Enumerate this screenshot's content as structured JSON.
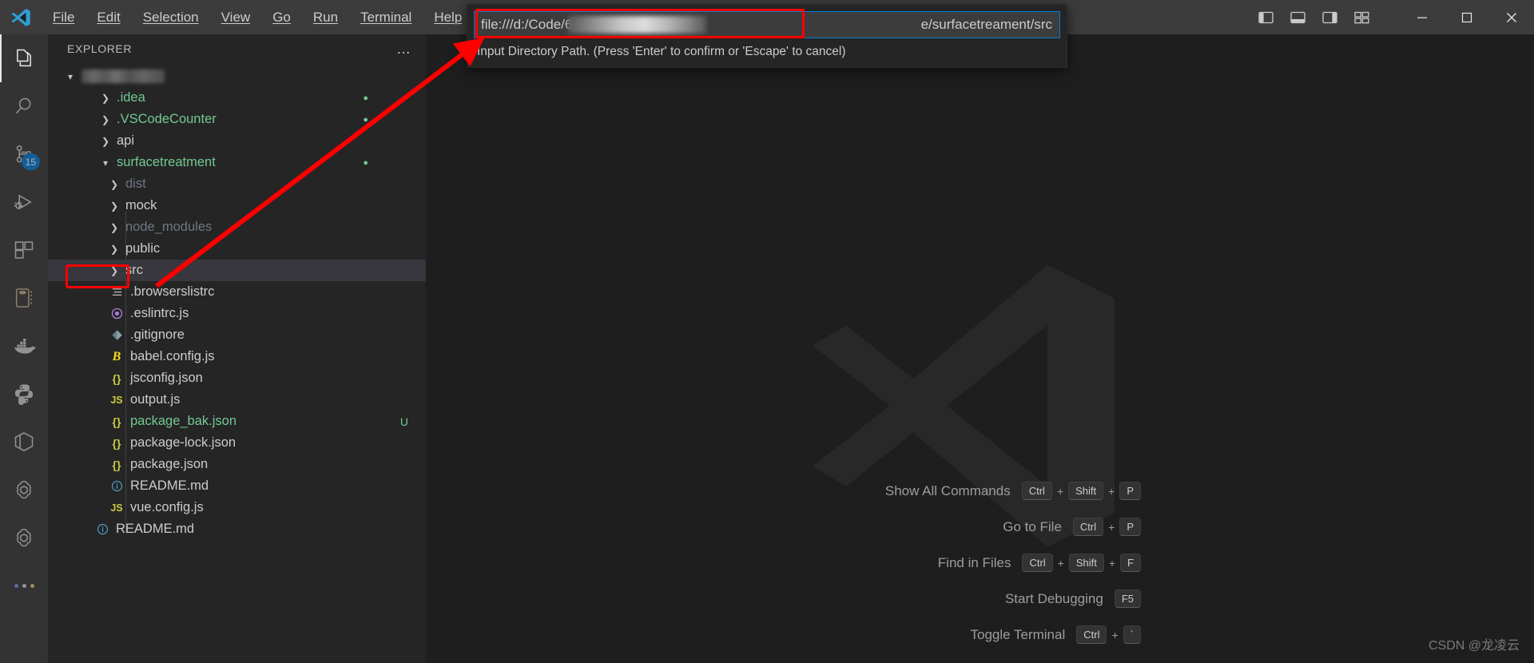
{
  "window": {
    "app_logo": "vscode-logo-icon",
    "menu": [
      "File",
      "Edit",
      "Selection",
      "View",
      "Go",
      "Run",
      "Terminal",
      "Help"
    ],
    "layout_icons": [
      "toggle-primary-sidebar-icon",
      "toggle-panel-icon",
      "toggle-secondary-sidebar-icon",
      "customize-layout-icon"
    ],
    "controls": [
      "minimize-button",
      "maximize-button",
      "close-button"
    ]
  },
  "activitybar": {
    "items": [
      {
        "name": "explorer",
        "icon": "files-icon",
        "active": true,
        "badge": null
      },
      {
        "name": "search",
        "icon": "search-icon",
        "active": false,
        "badge": null
      },
      {
        "name": "source-control",
        "icon": "source-control-icon",
        "active": false,
        "badge": "15"
      },
      {
        "name": "run-and-debug",
        "icon": "debug-icon",
        "active": false,
        "badge": null
      },
      {
        "name": "extensions",
        "icon": "extensions-icon",
        "active": false,
        "badge": null
      },
      {
        "name": "database",
        "icon": "database-notebook-icon",
        "active": false,
        "badge": null
      },
      {
        "name": "docker",
        "icon": "docker-whale-icon",
        "active": false,
        "badge": null
      },
      {
        "name": "python",
        "icon": "python-icon",
        "active": false,
        "badge": null
      },
      {
        "name": "cube",
        "icon": "cube-hexagon-icon",
        "active": false,
        "badge": null
      },
      {
        "name": "openai-1",
        "icon": "openai-icon",
        "active": false,
        "badge": null
      },
      {
        "name": "openai-2",
        "icon": "openai-icon",
        "active": false,
        "badge": null
      },
      {
        "name": "more",
        "icon": "more-dots-icon",
        "active": false,
        "badge": null
      }
    ],
    "badge_color": "#0078d4"
  },
  "sidebar": {
    "title": "EXPLORER",
    "more_actions": "…",
    "root_folder_name_redacted": true,
    "tree": [
      {
        "label": "",
        "type": "folder",
        "expanded": true,
        "indent": 0,
        "redacted": true,
        "color": "normal"
      },
      {
        "label": ".idea",
        "type": "folder",
        "expanded": false,
        "indent": 1,
        "color": "green",
        "deco": "●"
      },
      {
        "label": ".VSCodeCounter",
        "type": "folder",
        "expanded": false,
        "indent": 1,
        "color": "green",
        "deco": "●"
      },
      {
        "label": "api",
        "type": "folder",
        "expanded": false,
        "indent": 1,
        "color": "normal"
      },
      {
        "label": "surfacetreatment",
        "type": "folder",
        "expanded": true,
        "indent": 1,
        "color": "green",
        "deco": "●"
      },
      {
        "label": "dist",
        "type": "folder",
        "expanded": false,
        "indent": 2,
        "color": "dim"
      },
      {
        "label": "mock",
        "type": "folder",
        "expanded": false,
        "indent": 2,
        "color": "normal"
      },
      {
        "label": "node_modules",
        "type": "folder",
        "expanded": false,
        "indent": 2,
        "color": "dim"
      },
      {
        "label": "public",
        "type": "folder",
        "expanded": false,
        "indent": 2,
        "color": "normal"
      },
      {
        "label": "src",
        "type": "folder",
        "expanded": false,
        "indent": 2,
        "color": "normal",
        "selected": true,
        "highlighted": true
      },
      {
        "label": ".browserslistrc",
        "type": "file",
        "icon": "list-file-icon",
        "indent": 2,
        "color": "normal"
      },
      {
        "label": ".eslintrc.js",
        "type": "file",
        "icon": "eslint-icon",
        "indent": 2,
        "color": "normal"
      },
      {
        "label": ".gitignore",
        "type": "file",
        "icon": "git-icon",
        "indent": 2,
        "color": "normal"
      },
      {
        "label": "babel.config.js",
        "type": "file",
        "icon": "babel-icon",
        "indent": 2,
        "color": "normal"
      },
      {
        "label": "jsconfig.json",
        "type": "file",
        "icon": "json-icon",
        "indent": 2,
        "color": "normal"
      },
      {
        "label": "output.js",
        "type": "file",
        "icon": "js-icon",
        "indent": 2,
        "color": "normal"
      },
      {
        "label": "package_bak.json",
        "type": "file",
        "icon": "json-icon",
        "indent": 2,
        "color": "green",
        "deco": "U"
      },
      {
        "label": "package-lock.json",
        "type": "file",
        "icon": "json-icon",
        "indent": 2,
        "color": "normal"
      },
      {
        "label": "package.json",
        "type": "file",
        "icon": "json-icon",
        "indent": 2,
        "color": "normal"
      },
      {
        "label": "README.md",
        "type": "file",
        "icon": "info-markdown-icon",
        "indent": 2,
        "color": "normal"
      },
      {
        "label": "vue.config.js",
        "type": "file",
        "icon": "js-icon",
        "indent": 2,
        "color": "normal"
      },
      {
        "label": "README.md",
        "type": "file",
        "icon": "info-markdown-icon",
        "indent": 1,
        "color": "normal"
      }
    ]
  },
  "quick_input": {
    "value_prefix": "file:///d:/Code/6",
    "value_suffix": "e/surfacetreament/src",
    "value_redacted_middle": true,
    "hint": "Input Directory Path. (Press 'Enter' to confirm or 'Escape' to cancel)",
    "annotation_color": "#ff0000"
  },
  "editor": {
    "watermark_logo": "vscode-large-logo-icon",
    "shortcuts": [
      {
        "label": "Show All Commands",
        "keys": [
          "Ctrl",
          "Shift",
          "P"
        ]
      },
      {
        "label": "Go to File",
        "keys": [
          "Ctrl",
          "P"
        ]
      },
      {
        "label": "Find in Files",
        "keys": [
          "Ctrl",
          "Shift",
          "F"
        ]
      },
      {
        "label": "Start Debugging",
        "keys": [
          "F5"
        ]
      },
      {
        "label": "Toggle Terminal",
        "keys": [
          "Ctrl",
          "`"
        ]
      }
    ],
    "separator": "+"
  },
  "watermark": "CSDN @龙凌云"
}
